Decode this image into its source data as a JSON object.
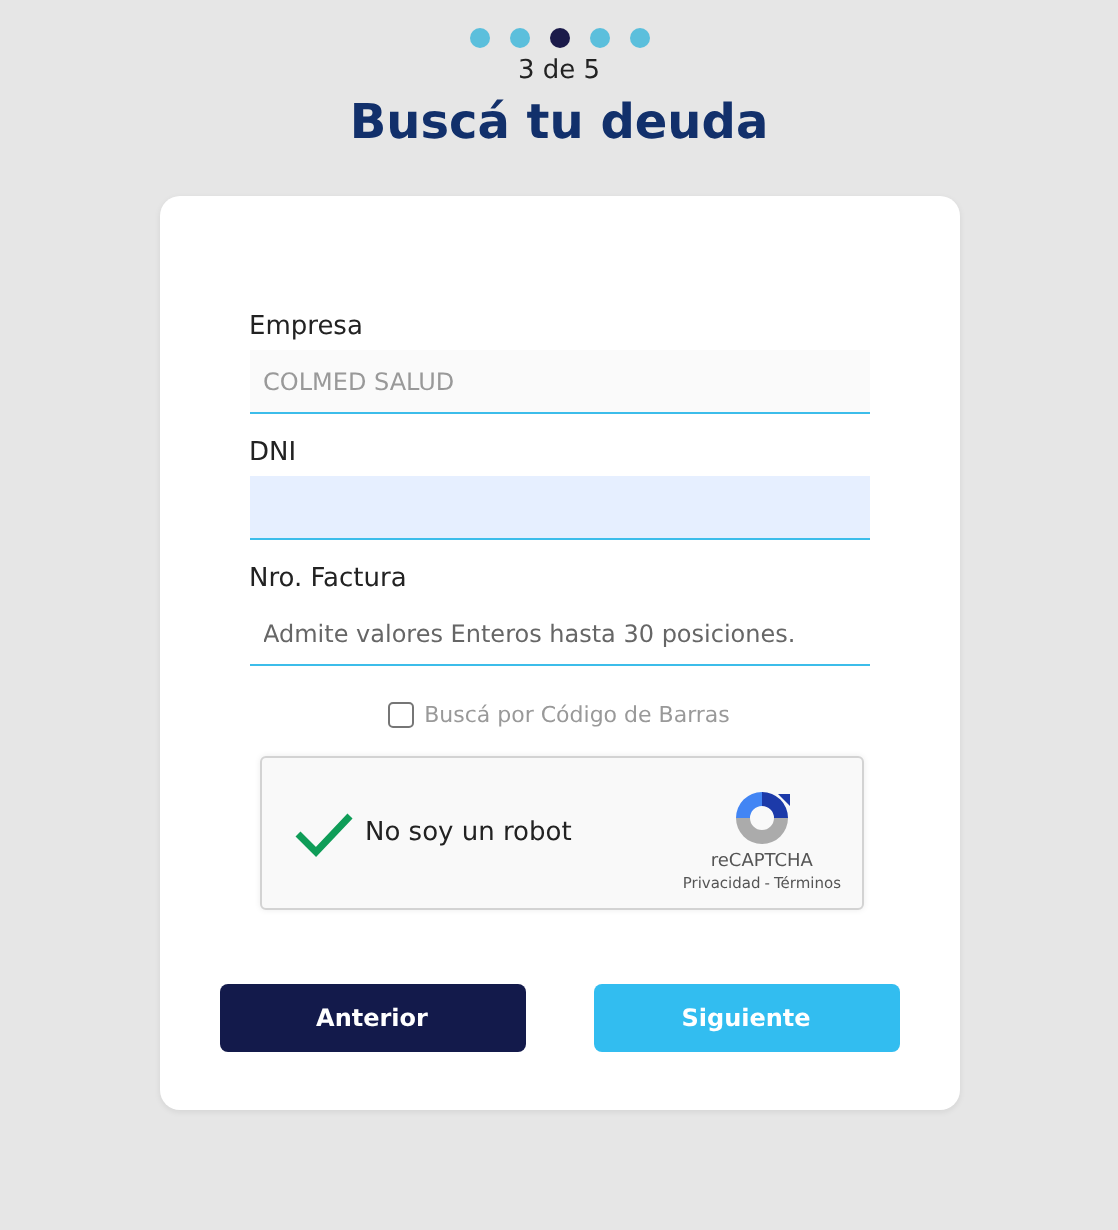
{
  "steps": [
    {
      "selected": false
    },
    {
      "selected": false
    },
    {
      "selected": true
    },
    {
      "selected": false
    },
    {
      "selected": false
    }
  ],
  "step_counter": "3 de 5",
  "title": "Buscá tu deuda",
  "fields": [
    {
      "label": "Empresa",
      "value": "COLMED SALUD",
      "disabled": true,
      "highlighted": false
    },
    {
      "label": "DNI",
      "disabled": false,
      "highlighted": true
    },
    {
      "label": "Nro. Factura",
      "placeholder": "Admite valores Enteros hasta 30 posiciones.",
      "disabled": false,
      "highlighted": false
    }
  ],
  "barcode_option": {
    "label": "Buscá por Código de Barras",
    "checked": false
  },
  "captcha": {
    "label": "No soy un robot",
    "checked": true,
    "brand": "reCAPTCHA",
    "privacy_link": "Privacidad",
    "separator": "-",
    "terms_link": "Términos"
  },
  "buttons": [
    {
      "label": "Anterior",
      "kind": "back"
    },
    {
      "label": "Siguiente",
      "kind": "next"
    }
  ]
}
